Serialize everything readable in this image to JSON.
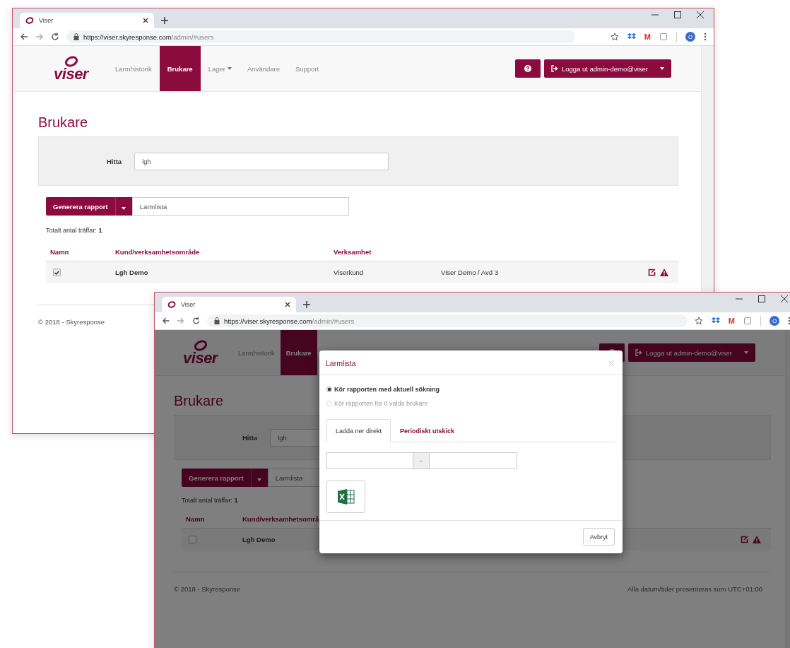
{
  "windows": [
    {
      "tab_title": "Viser",
      "url_host": "https://viser.skyresponse.com",
      "url_path": "/admin/#users",
      "toolbar_letter": "M",
      "profile_initial": "O",
      "logo_text": "viser",
      "nav": [
        {
          "label": "Larmhistorik",
          "selected": false,
          "kind": "link"
        },
        {
          "label": "Brukare",
          "selected": true,
          "kind": "link"
        },
        {
          "label": "Lager",
          "selected": false,
          "kind": "dropdown"
        },
        {
          "label": "Användare",
          "selected": false,
          "kind": "link"
        },
        {
          "label": "Support",
          "selected": false,
          "kind": "link"
        }
      ],
      "logout_label": "Logga ut admin-demo@viser",
      "page_title": "Brukare",
      "search_label": "Hitta",
      "search_value": "lgh",
      "report_button": "Generera rapport",
      "report_value": "Larmlista",
      "total_text": "Totalt antal träffar: **1**",
      "columns": [
        "Namn",
        "Kund/verksamhetsområde",
        "Verksamhet"
      ],
      "rows": [
        {
          "checked": true,
          "cells": [
            "",
            "Lgh Demo",
            "Viserkund",
            "Viser Demo / Avd 3"
          ]
        }
      ],
      "footer_left": "© 2018 - Skyresponse"
    },
    {
      "tab_title": "Viser",
      "url_host": "https://viser.skyresponse.com",
      "url_path": "/admin/#users",
      "toolbar_letter": "M",
      "profile_initial": "O",
      "logo_text": "viser",
      "nav": [
        {
          "label": "Larmhistorik",
          "selected": false,
          "kind": "link"
        },
        {
          "label": "Brukare",
          "selected": true,
          "kind": "link"
        }
      ],
      "logout_label": "Logga ut admin-demo@viser",
      "page_title": "Brukare",
      "search_label": "Hitta",
      "search_value": "lgh",
      "report_button": "Generera rapport",
      "report_value": "Larmlista",
      "total_text": "Totalt antal träffar: **1**",
      "columns": [
        "Namn",
        "Kund/verksamhetsområ"
      ],
      "rows": [
        {
          "checked": false,
          "cells": [
            "",
            "Lgh Demo"
          ]
        }
      ],
      "footer_left": "© 2018 - Skyresponse",
      "footer_right": "Alla datum/tider presenteras som UTC+01:00",
      "modal": {
        "title": "Larmlista",
        "options": [
          {
            "label": "Kör rapporten med aktuell sökning",
            "selected": true,
            "disabled": false
          },
          {
            "label": "Kör rapporten för 0 valda brukare",
            "selected": false,
            "disabled": true
          }
        ],
        "tabs": [
          {
            "label": "Ladda ner direkt",
            "selected": true
          },
          {
            "label": "Periodiskt utskick",
            "selected": false
          }
        ],
        "range_separator": "-",
        "cancel_button": "Avbryt"
      }
    }
  ]
}
